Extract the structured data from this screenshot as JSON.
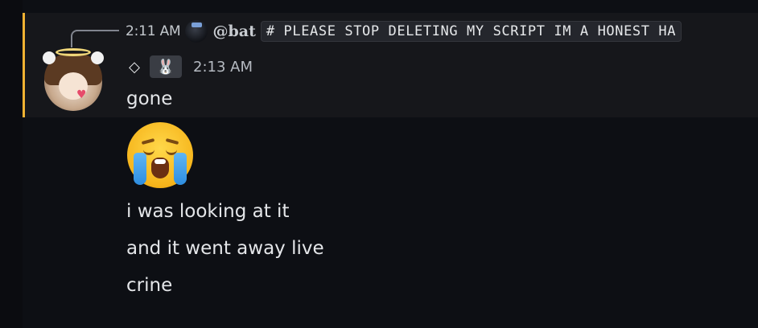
{
  "reply": {
    "time": "2:11 AM",
    "username": "@bat",
    "snippet": "# PLEASE STOP DELETING MY SCRIPT IM A HONEST HA"
  },
  "header": {
    "badge_icon": "diamond-icon",
    "role_icon": "bunny-icon",
    "role_glyph": "🐰",
    "timestamp": "2:13 AM"
  },
  "messages": [
    "gone",
    "i was looking at it",
    "and it went away live",
    "crine"
  ],
  "emoji": {
    "name": "sob-emoji"
  },
  "colors": {
    "mention_bar": "#f0b232",
    "background": "#0d0f14",
    "highlight": "#16171b"
  }
}
